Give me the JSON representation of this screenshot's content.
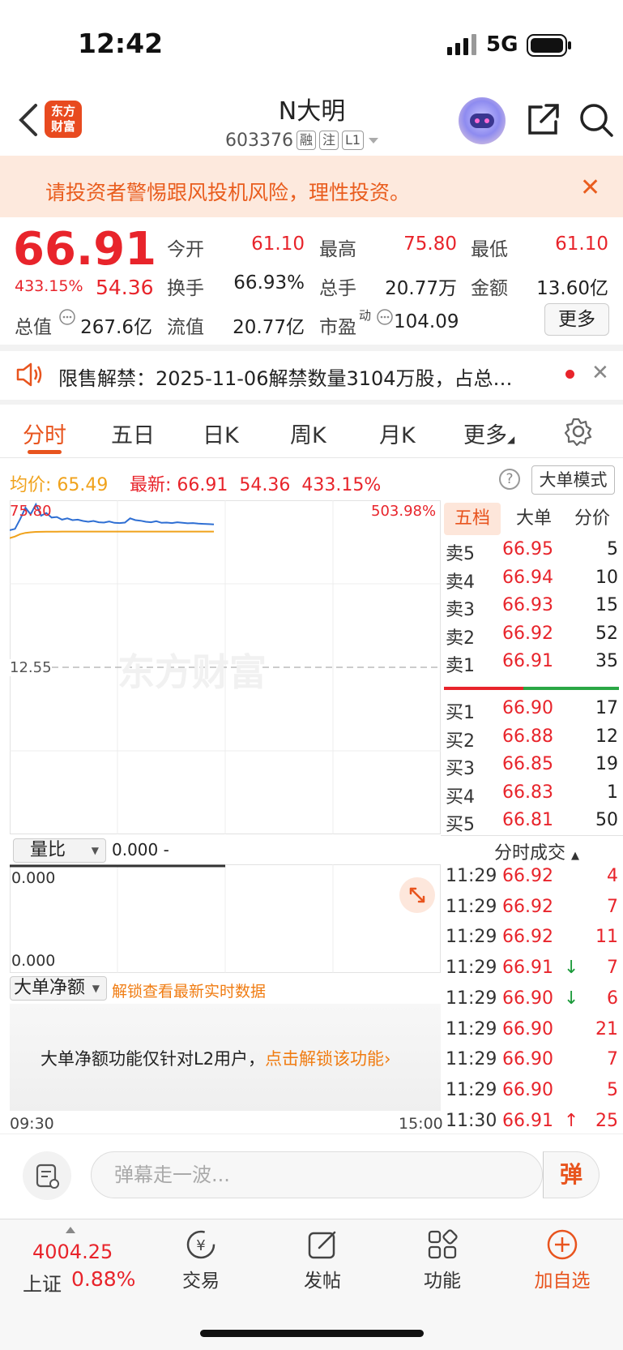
{
  "status": {
    "time": "12:42",
    "network": "5G"
  },
  "header": {
    "logo_line1": "东方",
    "logo_line2": "财富",
    "stock_name": "N大明",
    "stock_code": "603376",
    "tags": [
      "融",
      "注",
      "L1"
    ]
  },
  "warning": {
    "text": "请投资者警惕跟风投机风险，理性投资。"
  },
  "quote": {
    "price": "66.91",
    "pct": "433.15%",
    "change": "54.36",
    "open_label": "今开",
    "open": "61.10",
    "high_label": "最高",
    "high": "75.80",
    "low_label": "最低",
    "low": "61.10",
    "turnover_label": "换手",
    "turnover": "66.93%",
    "volume_label": "总手",
    "volume": "20.77万",
    "amount_label": "金额",
    "amount": "13.60亿",
    "mcap_label": "总值",
    "mcap": "267.6亿",
    "float_label": "流值",
    "float_val": "20.77亿",
    "pe_label": "市盈",
    "pe_sup": "动",
    "pe": "104.09",
    "more": "更多"
  },
  "notice": {
    "text": "限售解禁：2025-11-06解禁数量3104万股，占总…"
  },
  "tabs": [
    "分时",
    "五日",
    "日K",
    "周K",
    "月K",
    "更多"
  ],
  "chart_header": {
    "avg_label": "均价:",
    "avg": "65.49",
    "latest_label": "最新:",
    "latest": "66.91",
    "latest_chg": "54.36",
    "latest_pct": "433.15%",
    "help": "?",
    "mode_btn": "大单模式"
  },
  "chart": {
    "top_price": "75.80",
    "top_pct": "503.98%",
    "mid_price": "12.55",
    "watermark": "东方财富",
    "volume_selector": "量比",
    "volume_value": "0.000 -",
    "vol_top": "0.000",
    "vol_bottom": "0.000",
    "bignet_selector": "大单净额",
    "bignet_unlock": "解锁查看最新实时数据",
    "l2_text": "大单净额功能仅针对L2用户，",
    "l2_link": "点击解锁该功能›",
    "time_start": "09:30",
    "time_end": "15:00"
  },
  "chart_data": {
    "type": "line",
    "ylim": [
      12.55,
      75.8
    ],
    "series": [
      {
        "values": [
          66.0,
          66.5,
          70.2,
          74.5,
          72.0,
          75.8,
          71.5,
          72.5,
          70.8,
          71.0,
          70.0,
          70.5,
          69.8,
          70.0,
          69.5,
          69.2,
          69.5,
          69.0,
          68.9,
          69.3,
          68.8,
          68.7,
          68.9,
          70.5,
          69.8,
          69.6,
          69.2,
          69.0,
          69.4,
          68.8,
          68.9,
          68.7,
          69.0,
          68.8,
          68.6,
          68.7,
          68.5,
          68.4,
          68.3,
          68.2
        ]
      },
      {
        "values": [
          63.0,
          63.6,
          64.5,
          65.0,
          65.2,
          65.35,
          65.4,
          65.45,
          65.45,
          65.45,
          65.48,
          65.48,
          65.48,
          65.49,
          65.49,
          65.49,
          65.49,
          65.49,
          65.49,
          65.49,
          65.49,
          65.49,
          65.49,
          65.49,
          65.49,
          65.49,
          65.49,
          65.49,
          65.49,
          65.49,
          65.49,
          65.49,
          65.49,
          65.49,
          65.49,
          65.49,
          65.49,
          65.49,
          65.49,
          65.49
        ]
      }
    ],
    "colors": [
      "#2f6fd3",
      "#f0a21b"
    ]
  },
  "orderbook": {
    "tabs": [
      "五档",
      "大单",
      "分价"
    ],
    "asks": [
      {
        "label": "卖5",
        "price": "66.95",
        "vol": "5"
      },
      {
        "label": "卖4",
        "price": "66.94",
        "vol": "10"
      },
      {
        "label": "卖3",
        "price": "66.93",
        "vol": "15"
      },
      {
        "label": "卖2",
        "price": "66.92",
        "vol": "52"
      },
      {
        "label": "卖1",
        "price": "66.91",
        "vol": "35"
      }
    ],
    "bids": [
      {
        "label": "买1",
        "price": "66.90",
        "vol": "17"
      },
      {
        "label": "买2",
        "price": "66.88",
        "vol": "12"
      },
      {
        "label": "买3",
        "price": "66.85",
        "vol": "19"
      },
      {
        "label": "买4",
        "price": "66.83",
        "vol": "1"
      },
      {
        "label": "买5",
        "price": "66.81",
        "vol": "50"
      }
    ]
  },
  "trades": {
    "header": "分时成交",
    "rows": [
      {
        "time": "11:29",
        "price": "66.92",
        "arrow": "",
        "vol": "4"
      },
      {
        "time": "11:29",
        "price": "66.92",
        "arrow": "",
        "vol": "7"
      },
      {
        "time": "11:29",
        "price": "66.92",
        "arrow": "",
        "vol": "11"
      },
      {
        "time": "11:29",
        "price": "66.91",
        "arrow": "↓",
        "vol": "7"
      },
      {
        "time": "11:29",
        "price": "66.90",
        "arrow": "↓",
        "vol": "6"
      },
      {
        "time": "11:29",
        "price": "66.90",
        "arrow": "",
        "vol": "21"
      },
      {
        "time": "11:29",
        "price": "66.90",
        "arrow": "",
        "vol": "7"
      },
      {
        "time": "11:29",
        "price": "66.90",
        "arrow": "",
        "vol": "5"
      },
      {
        "time": "11:30",
        "price": "66.91",
        "arrow": "↑",
        "vol": "25"
      }
    ]
  },
  "comment": {
    "placeholder": "弹幕走一波...",
    "danmu": "弹"
  },
  "bottom_nav": {
    "index_value": "4004.25",
    "index_name": "上证",
    "index_pct": "0.88%",
    "items": [
      "交易",
      "发帖",
      "功能",
      "加自选"
    ]
  }
}
